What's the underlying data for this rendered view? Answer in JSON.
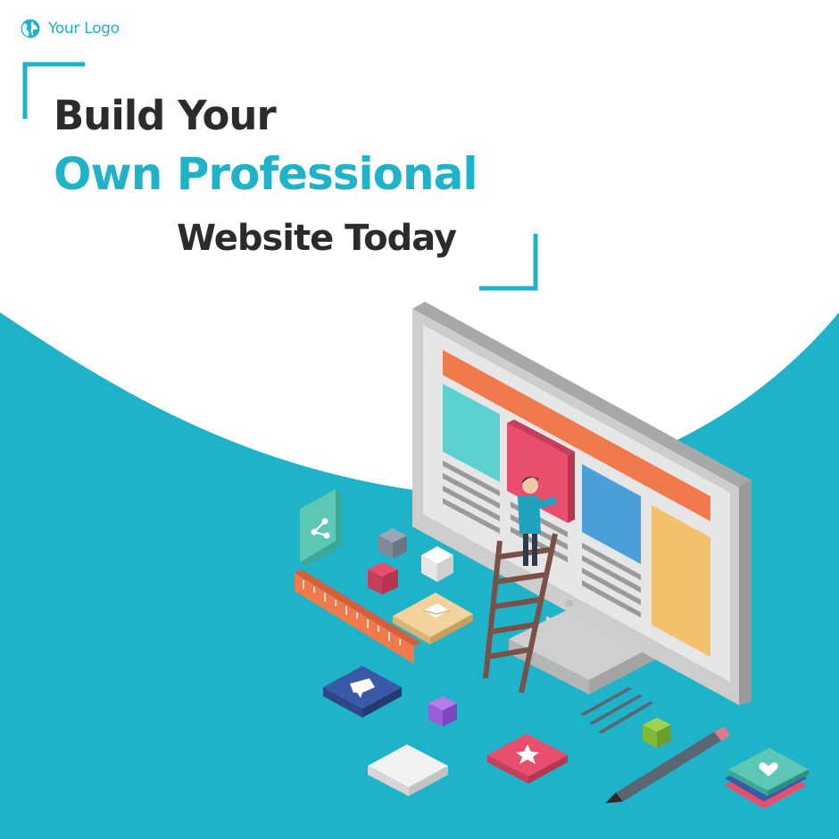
{
  "brand": {
    "logo_text": "Your Logo",
    "logo_icon": "globe-icon"
  },
  "headline": {
    "line1": "Build Your",
    "line2": "Own Professional",
    "line3": "Website Today"
  },
  "colors": {
    "accent": "#1fb3c9",
    "dark_text": "#2b2b2b",
    "background": "#ffffff",
    "orange": "#f07a4c",
    "teal_card": "#5bd1cf",
    "pink_card": "#e94f6d",
    "blue_card": "#4a9fd9",
    "yellow_card": "#f3c06b"
  },
  "icons": [
    "share-icon",
    "mail-icon",
    "chat-icon",
    "star-icon",
    "heart-icon"
  ]
}
